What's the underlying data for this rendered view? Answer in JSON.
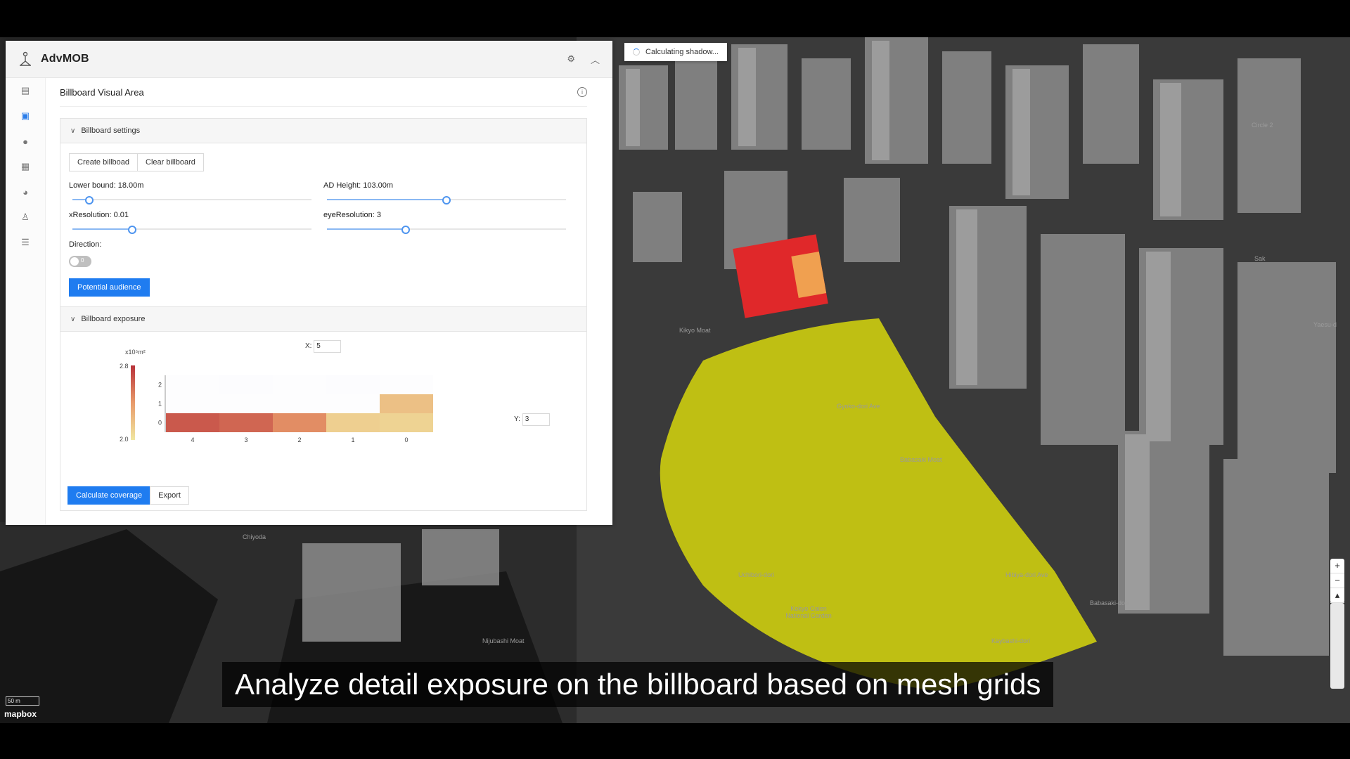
{
  "app": {
    "name": "AdvMOB"
  },
  "toast": {
    "text": "Calculating shadow..."
  },
  "page": {
    "title": "Billboard Visual Area"
  },
  "settings": {
    "title": "Billboard settings",
    "create_label": "Create billboad",
    "clear_label": "Clear billboard",
    "lower_bound_label": "Lower bound: 18.00m",
    "lower_bound_level": 0.07,
    "ad_height_label": "AD Height: 103.00m",
    "ad_height_level": 0.5,
    "xres_label": "xResolution: 0.01",
    "xres_level": 0.25,
    "eyeres_label": "eyeResolution: 3",
    "eyeres_level": 0.33,
    "direction_label": "Direction:",
    "direction_value": "0",
    "audience_button": "Potential audience"
  },
  "exposure": {
    "title": "Billboard exposure",
    "x_label": "X:",
    "x_value": "5",
    "y_label": "Y:",
    "y_value": "3",
    "calculate_button": "Calculate coverage",
    "export_button": "Export"
  },
  "chart_data": {
    "type": "heatmap",
    "x_ticks": [
      "4",
      "3",
      "2",
      "1",
      "0"
    ],
    "y_ticks": [
      "0",
      "1",
      "2"
    ],
    "colorbar_unit": "x10⁵m²",
    "colorbar_range": [
      2.0,
      2.8
    ],
    "colorbar_tick_labels": [
      "2.8",
      "2.0"
    ],
    "values": [
      [
        2.65,
        2.6,
        2.45,
        2.12,
        2.1
      ],
      [
        2.02,
        2.02,
        2.02,
        2.02,
        2.2
      ],
      [
        2.01,
        2.03,
        2.01,
        2.03,
        2.0
      ]
    ],
    "colors": {
      "high": "#b8323a",
      "mid": "#e89a6a",
      "low": "#f0e6a0"
    }
  },
  "map": {
    "caption": "Analyze detail exposure on the billboard based on mesh grids",
    "scale_label": "50 m",
    "attribution": "mapbox",
    "labels": [
      "Chiyoda",
      "Uchibori-dori",
      "Kokyo Gaien National Garden",
      "Babasaki-dori",
      "Hibiya-dori Ave",
      "Nijubashi Moat",
      "Kikyo Moat",
      "Gyoko-dori Ave",
      "Babasaki Moat",
      "Yaesu-d",
      "Kaybashi-dori",
      "Sak",
      "Circle 2"
    ]
  },
  "colors": {
    "accent": "#1f7cf0",
    "coverage": "#d2d20e",
    "billboard": "#e0282a"
  }
}
